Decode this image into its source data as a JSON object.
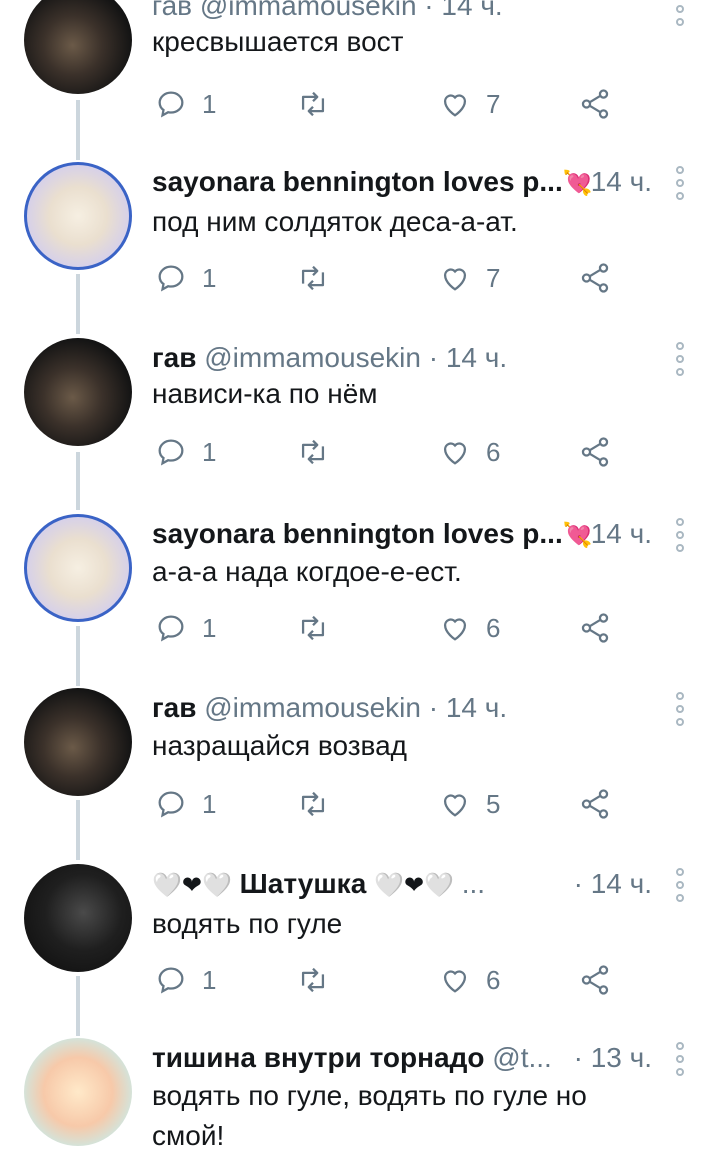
{
  "tweets": [
    {
      "name": "",
      "header_partial": "гав @immamousekin · 14 ч.",
      "text": "кресвышается вост",
      "replies": "1",
      "retweets": "",
      "likes": "7"
    },
    {
      "name": "sayonara bennington loves p...",
      "name_emoji": "💘",
      "time": "14 ч.",
      "text": "под ним солдяток деса-а-ат.",
      "replies": "1",
      "retweets": "",
      "likes": "7"
    },
    {
      "name": "гав",
      "handle": "@immamousekin",
      "time": "· 14 ч.",
      "text": "нависи-ка по нём",
      "replies": "1",
      "retweets": "",
      "likes": "6"
    },
    {
      "name": "sayonara bennington loves p...",
      "name_emoji": "💘",
      "time": "14 ч.",
      "text": "а-а-а нада когдое-е-ест.",
      "replies": "1",
      "retweets": "",
      "likes": "6"
    },
    {
      "name": "гав",
      "handle": "@immamousekin",
      "time": "· 14 ч.",
      "text": "назращайся возвад",
      "replies": "1",
      "retweets": "",
      "likes": "5"
    },
    {
      "name": "Шатушка",
      "name_prefix": "🤍❤🤍",
      "name_suffix": "🤍❤🤍",
      "handle": "...",
      "time": "· 14 ч.",
      "text": "водять по гуле",
      "replies": "1",
      "retweets": "",
      "likes": "6"
    },
    {
      "name": "тишина внутри торнадо",
      "handle": "@t...",
      "time": "· 13 ч.",
      "text": "водять по гуле, водять по гуле но смой!"
    }
  ]
}
